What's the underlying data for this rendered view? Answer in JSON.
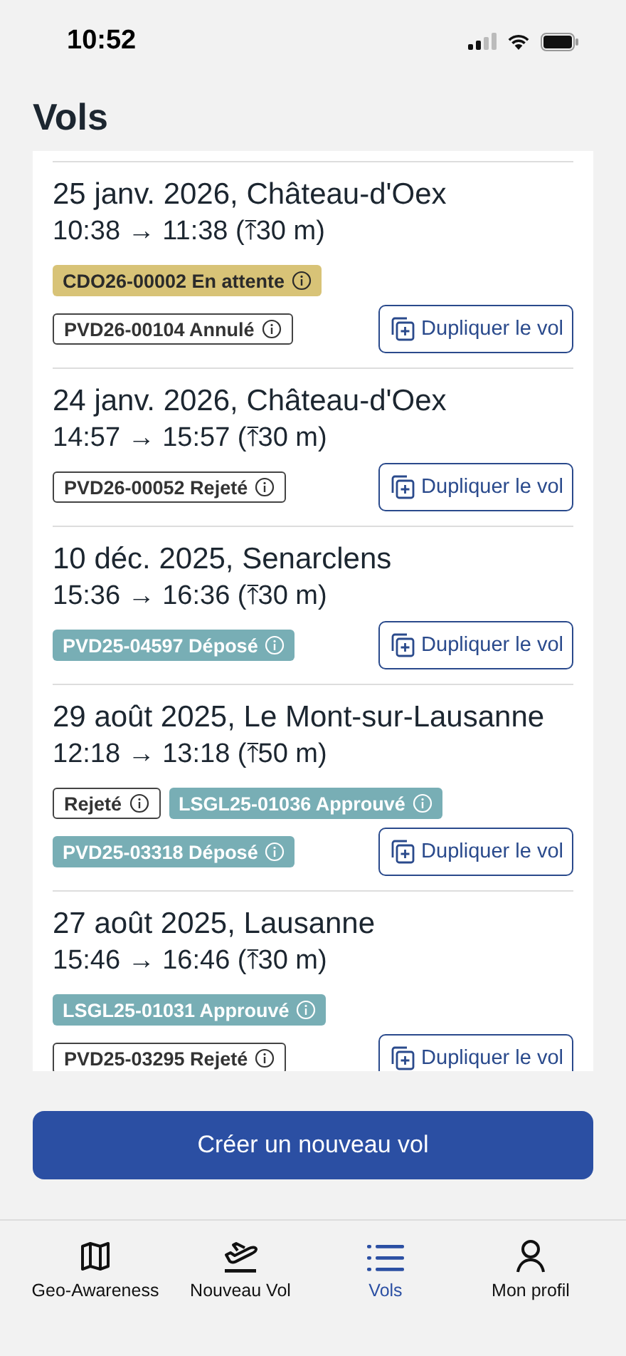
{
  "status_bar": {
    "time": "10:52"
  },
  "header": {
    "title": "Vols"
  },
  "flights": [
    {
      "title": "25 janv. 2026, Château-d'Oex",
      "times": "10:38 → 11:38 (⤒30 m)",
      "badge_rows": [
        [
          {
            "text": "CDO26-00002 En attente",
            "kind": "pending"
          }
        ],
        [
          {
            "text": "PVD26-00104 Annulé",
            "kind": "outline"
          }
        ]
      ],
      "duplicate_button": "Dupliquer le vol"
    },
    {
      "title": "24 janv. 2026, Château-d'Oex",
      "times": "14:57 → 15:57 (⤒30 m)",
      "badge_rows": [
        [
          {
            "text": "PVD26-00052 Rejeté",
            "kind": "outline"
          }
        ]
      ],
      "duplicate_button": "Dupliquer le vol"
    },
    {
      "title": "10 déc. 2025, Senarclens",
      "times": "15:36 → 16:36 (⤒30 m)",
      "badge_rows": [
        [
          {
            "text": "PVD25-04597 Déposé",
            "kind": "teal"
          }
        ]
      ],
      "duplicate_button": "Dupliquer le vol"
    },
    {
      "title": "29 août 2025, Le Mont-sur-Lausanne",
      "times": "12:18 → 13:18 (⤒50 m)",
      "badge_rows": [
        [
          {
            "text": "Rejeté",
            "kind": "outline"
          },
          {
            "text": "LSGL25-01036 Approuvé",
            "kind": "teal"
          }
        ],
        [
          {
            "text": "PVD25-03318 Déposé",
            "kind": "teal"
          }
        ]
      ],
      "duplicate_button": "Dupliquer le vol"
    },
    {
      "title": "27 août 2025, Lausanne",
      "times": "15:46 → 16:46 (⤒30 m)",
      "badge_rows": [
        [
          {
            "text": "LSGL25-01031 Approuvé",
            "kind": "teal"
          }
        ],
        [
          {
            "text": "PVD25-03295 Rejeté",
            "kind": "outline"
          }
        ]
      ],
      "duplicate_button": "Dupliquer le vol"
    }
  ],
  "create_button": "Créer un nouveau vol",
  "tabs": [
    {
      "label": "Geo-Awareness",
      "kind": "map",
      "selected": false
    },
    {
      "label": "Nouveau Vol",
      "kind": "takeoff",
      "selected": false
    },
    {
      "label": "Vols",
      "kind": "list",
      "selected": true
    },
    {
      "label": "Mon profil",
      "kind": "profile",
      "selected": false
    }
  ]
}
